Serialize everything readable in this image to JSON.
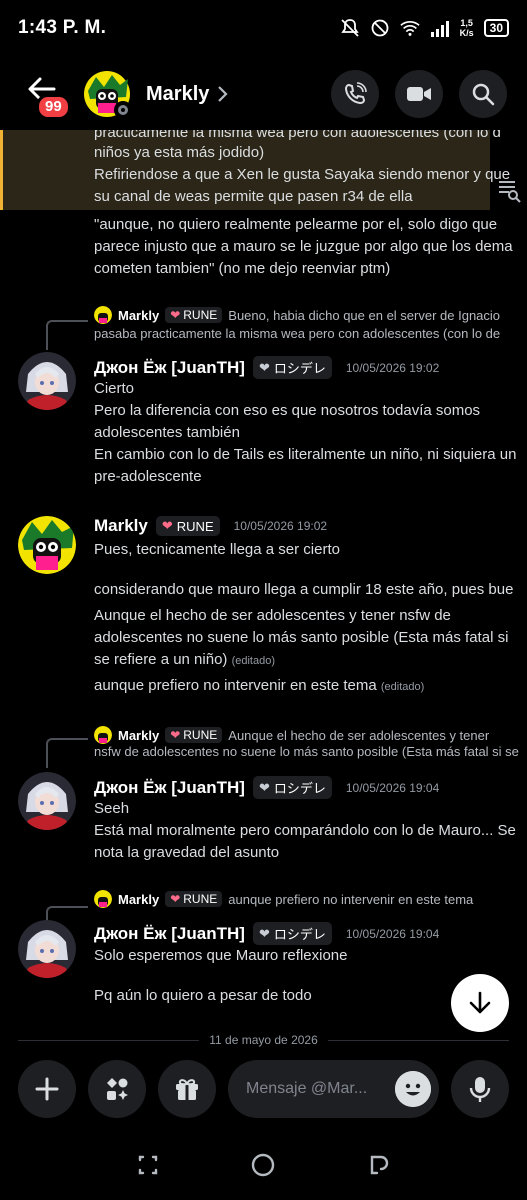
{
  "status": {
    "time": "1:43 P. M.",
    "speed_top": "1,5",
    "speed_bottom": "K/s",
    "battery": "30"
  },
  "header": {
    "unread_badge": "99",
    "name": "Markly",
    "icons": [
      "back-arrow-icon",
      "phone-icon",
      "video-icon",
      "search-icon"
    ]
  },
  "highlight": {
    "lines": [
      "practicamente la misma wea pero con adolescentes (con lo d",
      "niños ya esta más jodido)",
      "Refiriendose a que a Xen le gusta Sayaka siendo menor y que",
      "su canal de weas permite que pasen r34 de ella"
    ],
    "accent": "#f0b232"
  },
  "quoted_message": [
    "\"aunque, no quiero realmente pelearme por el, solo digo que",
    "parece injusto que a mauro se le juzgue por algo que los dema",
    "cometen tambien\" (no me dejo reenviar ptm)"
  ],
  "messages": [
    {
      "reply": {
        "name": "Markly",
        "tag": "RUNE",
        "text": "Bueno, habia dicho que en el server de Ignacio",
        "text2": "pasaba practicamente la misma wea pero con adolescentes (con lo de"
      },
      "author": "Джон Ёж [JuanTH]",
      "tag": "ロシデレ",
      "timestamp": "10/05/2026 19:02",
      "lines": [
        "Cierto",
        "Pero la diferencia con eso es que nosotros todavía somos",
        "adolescentes también",
        "En cambio con lo de Tails es literalmente un niño, ni siquiera un",
        "pre-adolescente"
      ]
    },
    {
      "author": "Markly",
      "tag": "RUNE",
      "timestamp": "10/05/2026 19:02",
      "lines": [
        "Pues, tecnicamente llega a ser cierto",
        "considerando que mauro llega a cumplir 18 este año, pues bue",
        "Aunque el hecho de ser adolescentes y tener nsfw de",
        "adolescentes no suene lo más santo posible (Esta más fatal si",
        "se refiere a un niño)",
        "aunque prefiero no intervenir en este tema"
      ],
      "edited": "(editado)"
    },
    {
      "reply": {
        "name": "Markly",
        "tag": "RUNE",
        "text": "Aunque el hecho de ser adolescentes y tener",
        "text2": "nsfw de adolescentes no suene lo más santo posible (Esta más fatal si se"
      },
      "author": "Джон Ёж [JuanTH]",
      "tag": "ロシデレ",
      "timestamp": "10/05/2026 19:04",
      "lines": [
        "Seeh",
        "Está mal moralmente pero comparándolo con lo de Mauro... Se",
        "nota la gravedad del asunto"
      ]
    },
    {
      "reply": {
        "name": "Markly",
        "tag": "RUNE",
        "text": "aunque prefiero no intervenir en este tema"
      },
      "author": "Джон Ёж [JuanTH]",
      "tag": "ロシデレ",
      "timestamp": "10/05/2026 19:04",
      "lines": [
        "Solo esperemos que Mauro reflexione",
        "Pq aún lo quiero a pesar de todo"
      ]
    }
  ],
  "day_divider": "11 de mayo de 2026",
  "composer": {
    "placeholder": "Mensaje @Mar...",
    "icons": [
      "plus-icon",
      "apps-icon",
      "gift-icon",
      "emoji-icon",
      "microphone-icon"
    ]
  },
  "navbar": {
    "icons": [
      "recents-icon",
      "home-icon",
      "back-icon"
    ]
  },
  "colors": {
    "background": "#000000",
    "surface": "#1e1f22",
    "badge": "#f23f43",
    "text": "#dbdee1",
    "muted": "#949ba4"
  }
}
